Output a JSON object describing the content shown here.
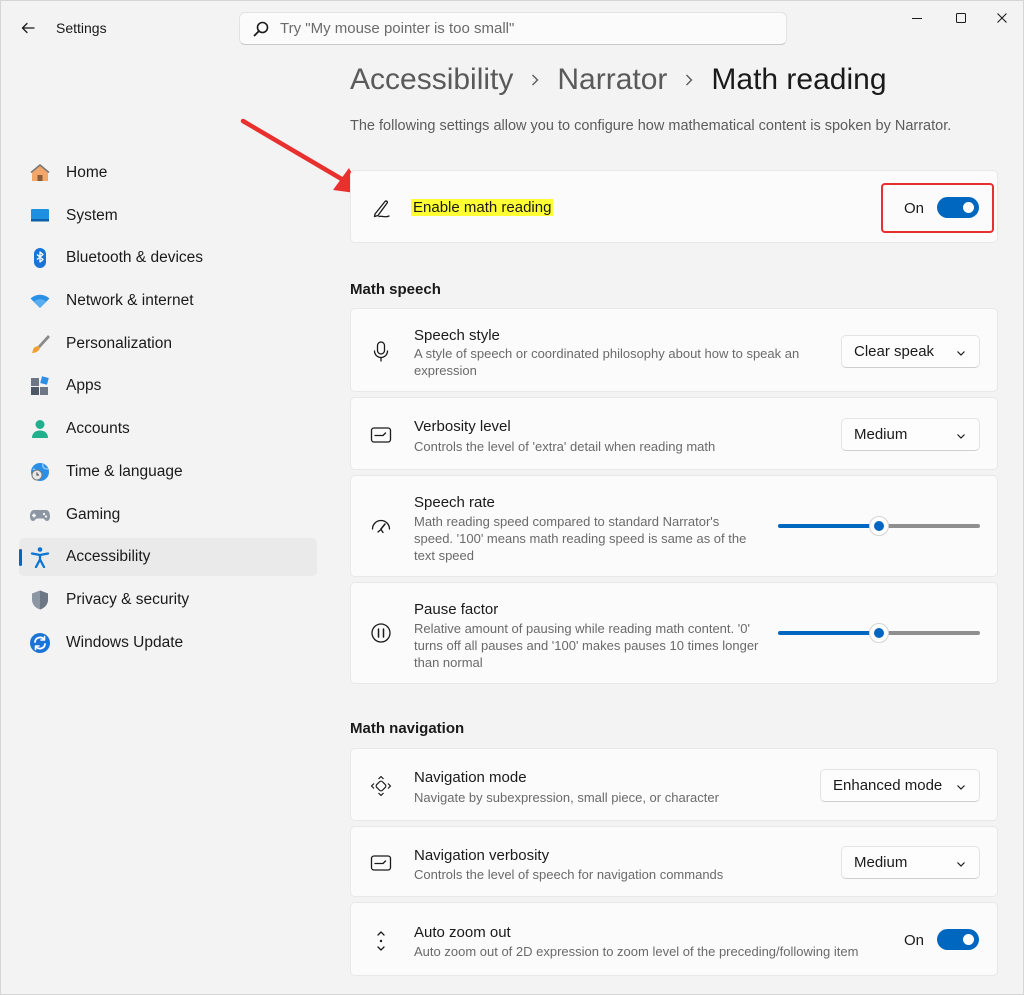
{
  "window": {
    "title": "Settings",
    "search_placeholder": "Try \"My mouse pointer is too small\""
  },
  "sidebar": {
    "items": [
      {
        "label": "Home",
        "icon": "home-icon"
      },
      {
        "label": "System",
        "icon": "system-icon"
      },
      {
        "label": "Bluetooth & devices",
        "icon": "bluetooth-icon"
      },
      {
        "label": "Network & internet",
        "icon": "wifi-icon"
      },
      {
        "label": "Personalization",
        "icon": "brush-icon"
      },
      {
        "label": "Apps",
        "icon": "apps-icon"
      },
      {
        "label": "Accounts",
        "icon": "account-icon"
      },
      {
        "label": "Time & language",
        "icon": "globe-clock-icon"
      },
      {
        "label": "Gaming",
        "icon": "gamepad-icon"
      },
      {
        "label": "Accessibility",
        "icon": "accessibility-icon",
        "active": true
      },
      {
        "label": "Privacy & security",
        "icon": "shield-icon"
      },
      {
        "label": "Windows Update",
        "icon": "update-icon"
      }
    ]
  },
  "breadcrumb": {
    "level1": "Accessibility",
    "level2": "Narrator",
    "current": "Math reading"
  },
  "page_description": "The following settings allow you to configure how mathematical content is spoken by Narrator.",
  "enable_math": {
    "label": "Enable math reading",
    "state": "On",
    "on": true
  },
  "math_speech": {
    "heading": "Math speech",
    "speech_style": {
      "title": "Speech style",
      "desc1": "A style of speech or coordinated philosophy about how to speak an",
      "desc2": "expression",
      "value": "Clear speak"
    },
    "verbosity": {
      "title": "Verbosity level",
      "desc1": "Controls the level of 'extra' detail when reading math",
      "value": "Medium"
    },
    "speech_rate": {
      "title": "Speech rate",
      "desc1": "Math reading speed compared to standard Narrator's",
      "desc2": "speed. '100' means math reading speed is same as of the",
      "desc3": "text speed",
      "level_fraction": 0.5
    },
    "pause_factor": {
      "title": "Pause factor",
      "desc1": "Relative amount of pausing while reading math content. '0'",
      "desc2": "turns off all pauses and '100' makes pauses 10 times longer",
      "desc3": "than normal",
      "level_fraction": 0.5
    }
  },
  "math_navigation": {
    "heading": "Math navigation",
    "navigation_mode": {
      "title": "Navigation mode",
      "desc1": "Navigate by subexpression, small piece, or character",
      "value": "Enhanced mode"
    },
    "navigation_verbosity": {
      "title": "Navigation verbosity",
      "desc1": "Controls the level of speech for navigation commands",
      "value": "Medium"
    },
    "auto_zoom": {
      "title": "Auto zoom out",
      "desc1": "Auto zoom out of 2D expression to zoom level of the preceding/following item",
      "state": "On",
      "on": true
    }
  },
  "colors": {
    "accent": "#0067c0",
    "highlight": "#ffff33",
    "annotation": "#e8302f"
  }
}
